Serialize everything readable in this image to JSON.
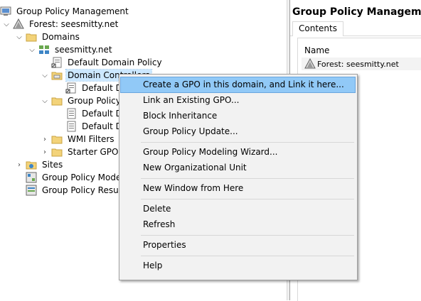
{
  "tree": {
    "root": "Group Policy Management",
    "forest": "Forest: seesmitty.net",
    "domains": "Domains",
    "domain": "seesmitty.net",
    "default_domain_policy": "Default Domain Policy",
    "domain_controllers": "Domain Controllers",
    "dc_child": "Default D",
    "group_policy": "Group Policy",
    "gp_child_1": "Default D",
    "gp_child_2": "Default D",
    "wmi_filters": "WMI Filters",
    "starter_gpos": "Starter GPOs",
    "sites": "Sites",
    "modeling": "Group Policy Modeli",
    "results": "Group Policy Results"
  },
  "right_pane": {
    "title": "Group Policy Management",
    "tab_contents": "Contents",
    "column_name": "Name",
    "row_forest": "Forest: seesmitty.net"
  },
  "context_menu": {
    "create_gpo": "Create a GPO in this domain, and Link it here...",
    "link_existing": "Link an Existing GPO...",
    "block_inheritance": "Block Inheritance",
    "gp_update": "Group Policy Update...",
    "modeling_wizard": "Group Policy Modeling Wizard...",
    "new_ou": "New Organizational Unit",
    "new_window": "New Window from Here",
    "delete": "Delete",
    "refresh": "Refresh",
    "properties": "Properties",
    "help": "Help"
  },
  "icons": {
    "expand": "chevron-right-icon",
    "collapse": "chevron-down-icon",
    "gpm": "group-policy-management-icon",
    "forest": "forest-icon",
    "folder": "folder-icon",
    "domain": "domain-icon",
    "gpo_link": "gpo-link-icon"
  }
}
